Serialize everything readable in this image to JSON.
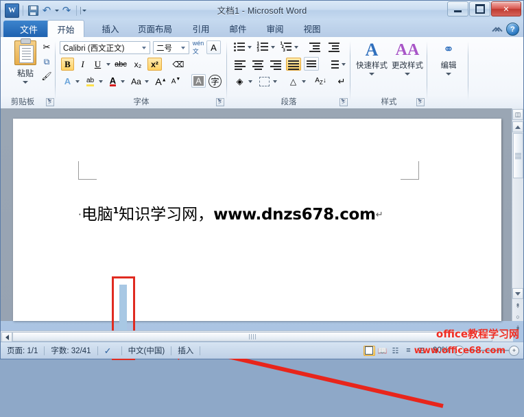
{
  "window": {
    "title": "文档1  -  Microsoft Word",
    "controls": {
      "minimize": "minimize-icon",
      "maximize": "maximize-icon",
      "close": "✕"
    }
  },
  "quick_access": {
    "word_logo": "W",
    "items": [
      {
        "name": "save-button",
        "icon": "save-icon"
      },
      {
        "name": "undo-button",
        "icon": "undo-icon",
        "glyph": "↶"
      },
      {
        "name": "redo-button",
        "icon": "redo-icon",
        "glyph": "↷"
      },
      {
        "name": "customize-qat-button",
        "icon": "chevron-down-icon"
      }
    ]
  },
  "tabs": [
    {
      "label": "文件",
      "active": false,
      "file": true
    },
    {
      "label": "开始",
      "active": true
    },
    {
      "label": "插入",
      "active": false
    },
    {
      "label": "页面布局",
      "active": false
    },
    {
      "label": "引用",
      "active": false
    },
    {
      "label": "邮件",
      "active": false
    },
    {
      "label": "审阅",
      "active": false
    },
    {
      "label": "视图",
      "active": false
    }
  ],
  "ribbon": {
    "help_button": "?",
    "groups": {
      "clipboard": {
        "label": "剪贴板",
        "paste_label": "粘贴",
        "buttons": [
          "剪切",
          "复制",
          "格式刷"
        ]
      },
      "font": {
        "label": "字体",
        "font_name": "Calibri (西文正文)",
        "font_size": "二号",
        "bold": "B",
        "italic": "I",
        "underline": "U",
        "strikethrough": "abc",
        "subscript": "x₂",
        "superscript": "x²",
        "clear_format": "clear-formatting",
        "text_effects": "A",
        "highlight": "ab",
        "font_color": "A",
        "change_case": "Aa",
        "grow_font": "A",
        "shrink_font": "A",
        "char_shading": "A",
        "char_border": "字",
        "phonetic": "wén",
        "enclose": "A"
      },
      "paragraph": {
        "label": "段落",
        "bullets": "bullets",
        "numbering": "numbering",
        "multilevel": "multilevel-list",
        "decrease_indent": "decrease-indent",
        "increase_indent": "increase-indent",
        "align_left": "align-left",
        "align_center": "align-center",
        "align_right": "align-right",
        "align_justify": "align-justify",
        "distribute": "distribute",
        "line_spacing": "line-spacing",
        "shading": "shading",
        "borders": "borders",
        "sort": "sort",
        "show_marks": "show-formatting-marks"
      },
      "styles": {
        "label": "样式",
        "quick_styles": "快速样式",
        "change_styles": "更改样式"
      },
      "editing": {
        "label": "编辑",
        "edit_label": "编辑"
      }
    }
  },
  "document": {
    "bullet": "·",
    "text_before": "电脑",
    "superscript": "1",
    "text_after": "知识学习网，",
    "url": "www.dnzs678.com",
    "paragraph_mark": "↵",
    "selection": "selected-superscript-char",
    "annotation_box": "red-highlight-rectangle",
    "annotation_arrow": "red-pointer-arrow"
  },
  "status_bar": {
    "page": "页面: 1/1",
    "words": "字数: 32/41",
    "proofing": "proofing-icon",
    "language": "中文(中国)",
    "insert_mode": "插入",
    "views": [
      {
        "name": "print-layout-view",
        "active": true
      },
      {
        "name": "full-screen-reading-view",
        "active": false
      },
      {
        "name": "web-layout-view",
        "active": false
      },
      {
        "name": "outline-view",
        "active": false
      },
      {
        "name": "draft-view",
        "active": false
      }
    ],
    "zoom": "90%",
    "zoom_out": "−",
    "zoom_in": "+"
  },
  "watermark": {
    "line1": "office教程学习网",
    "line2": "www.office68.com"
  },
  "colors": {
    "accent": "#1f62b0",
    "annotation": "#e02b20",
    "selection": "#a8c8e4",
    "highlight": "#ffd264",
    "watermark": "#f02d22"
  }
}
